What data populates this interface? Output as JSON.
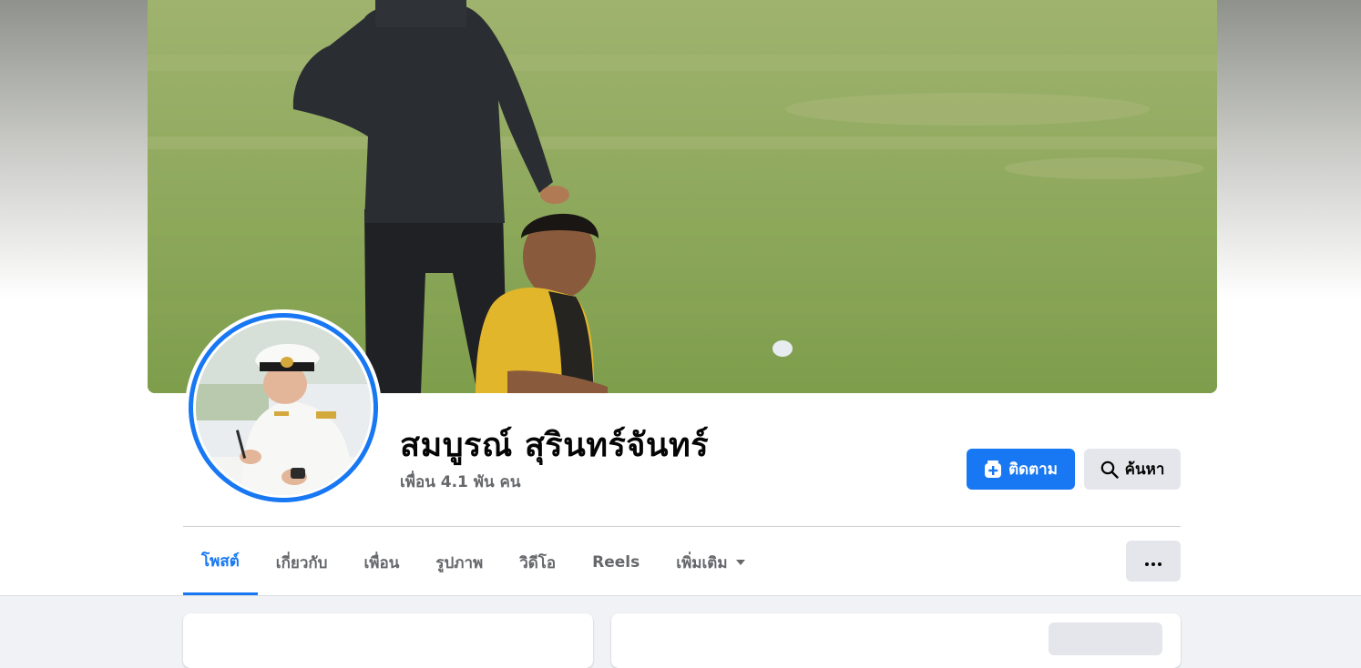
{
  "profile": {
    "name": "สมบูรณ์ สุรินทร์จันทร์",
    "friends": "เพื่อน 4.1 พัน คน"
  },
  "actions": {
    "follow_label": "ติดตาม",
    "search_label": "ค้นหา"
  },
  "tabs": [
    {
      "label": "โพสต์",
      "active": true
    },
    {
      "label": "เกี่ยวกับ",
      "active": false
    },
    {
      "label": "เพื่อน",
      "active": false
    },
    {
      "label": "รูปภาพ",
      "active": false
    },
    {
      "label": "วิดีโอ",
      "active": false
    },
    {
      "label": "Reels",
      "active": false
    },
    {
      "label": "เพิ่มเติม",
      "active": false
    }
  ],
  "icons": {
    "follow": "follow-plus-icon",
    "search": "search-icon",
    "more_tab": "caret-down-icon",
    "more_menu": "ellipsis-icon"
  },
  "colors": {
    "accent": "#1877f2",
    "secondary_button": "#e4e6eb",
    "text_primary": "#050505",
    "text_secondary": "#65676b"
  }
}
